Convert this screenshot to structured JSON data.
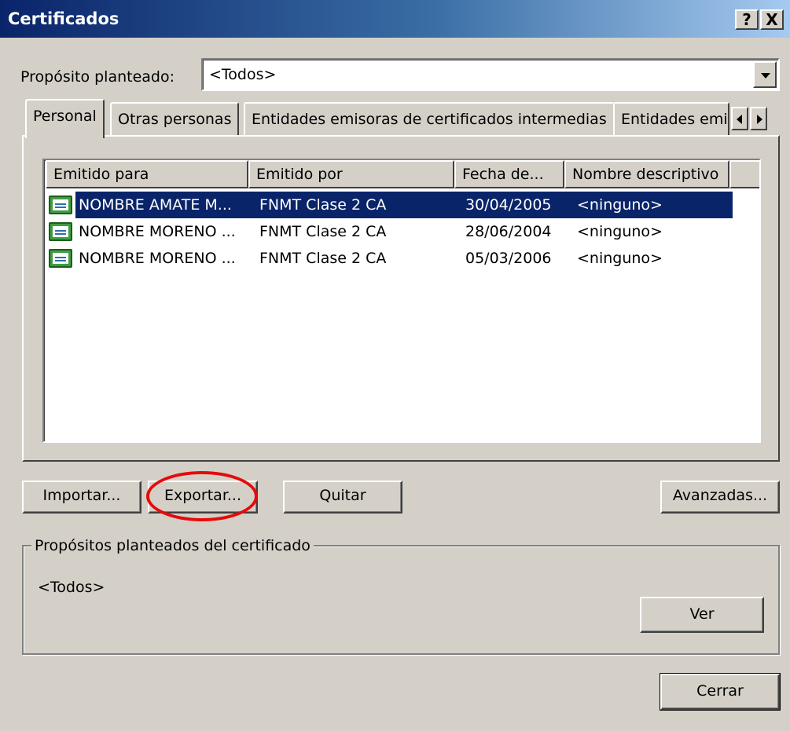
{
  "window": {
    "title": "Certificados",
    "help_label": "?",
    "close_label": "X"
  },
  "purpose": {
    "label": "Propósito planteado:",
    "value": "<Todos>"
  },
  "tabs": [
    {
      "label": "Personal",
      "active": true
    },
    {
      "label": "Otras personas",
      "active": false
    },
    {
      "label": "Entidades emisoras de certificados intermedias",
      "active": false
    },
    {
      "label": "Entidades emi",
      "active": false
    }
  ],
  "table": {
    "columns": [
      "Emitido para",
      "Emitido por",
      "Fecha de...",
      "Nombre descriptivo"
    ],
    "rows": [
      {
        "issued_to": "NOMBRE AMATE M...",
        "issued_by": "FNMT Clase 2 CA",
        "date": "30/04/2005",
        "friendly_name": "<ninguno>",
        "selected": true
      },
      {
        "issued_to": "NOMBRE MORENO ...",
        "issued_by": "FNMT Clase 2 CA",
        "date": "28/06/2004",
        "friendly_name": "<ninguno>",
        "selected": false
      },
      {
        "issued_to": "NOMBRE MORENO ...",
        "issued_by": "FNMT Clase 2 CA",
        "date": "05/03/2006",
        "friendly_name": "<ninguno>",
        "selected": false
      }
    ]
  },
  "buttons": {
    "import": "Importar...",
    "export": "Exportar...",
    "remove": "Quitar",
    "advanced": "Avanzadas...",
    "view": "Ver",
    "close": "Cerrar"
  },
  "purposes_group": {
    "legend": "Propósitos planteados del certificado",
    "value": "<Todos>"
  },
  "colors": {
    "selection": "#0a246a",
    "highlight_circle": "#e60a0a",
    "dialog_face": "#d4d0c8"
  }
}
